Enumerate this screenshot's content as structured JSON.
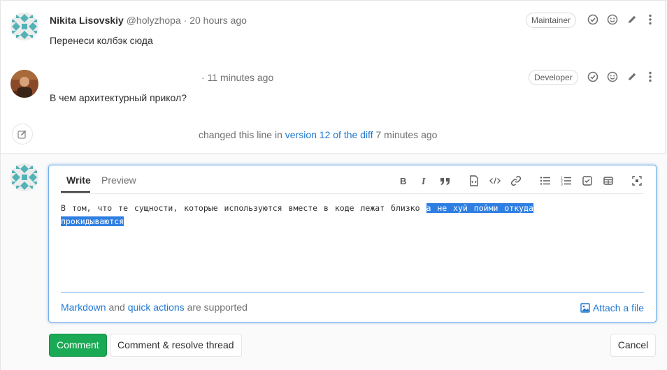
{
  "notes": [
    {
      "author_name": "Nikita Lisovskiy",
      "author_handle": "@holyzhopa",
      "time": "· 20 hours ago",
      "role": "Maintainer",
      "body": "Перенеси колбэк сюда"
    },
    {
      "author_name": "",
      "author_handle": "",
      "time": "· 11 minutes ago",
      "role": "Developer",
      "body": "В чем архитектурный прикол?"
    }
  ],
  "system_note": {
    "prefix": "changed this line in",
    "link": "version 12 of the diff",
    "time": "7 minutes ago"
  },
  "editor": {
    "tab_write": "Write",
    "tab_preview": "Preview",
    "text_plain": "В том, что те сущности, которые используются вместе в коде лежат близко ",
    "text_selected": "а не хуй пойми откуда прокидываются",
    "markdown_link": "Markdown",
    "and_text": "and",
    "quick_actions_link": "quick actions",
    "supported_text": "are supported",
    "attach_label": "Attach a file"
  },
  "buttons": {
    "comment": "Comment",
    "comment_resolve": "Comment & resolve thread",
    "cancel": "Cancel"
  },
  "icons": {
    "note_actions": [
      "resolve-icon",
      "emoji-icon",
      "edit-icon",
      "more-icon"
    ],
    "toolbar": [
      "bold-icon",
      "italic-icon",
      "quote-icon",
      "code-icon",
      "code-block-icon",
      "link-icon",
      "bullet-list-icon",
      "numbered-list-icon",
      "task-list-icon",
      "table-icon",
      "fullscreen-icon"
    ]
  },
  "colors": {
    "link": "#1f78d1",
    "comment_button": "#1aaa55",
    "selection": "#2f7fe2",
    "editor_focus_border": "#73afea"
  }
}
